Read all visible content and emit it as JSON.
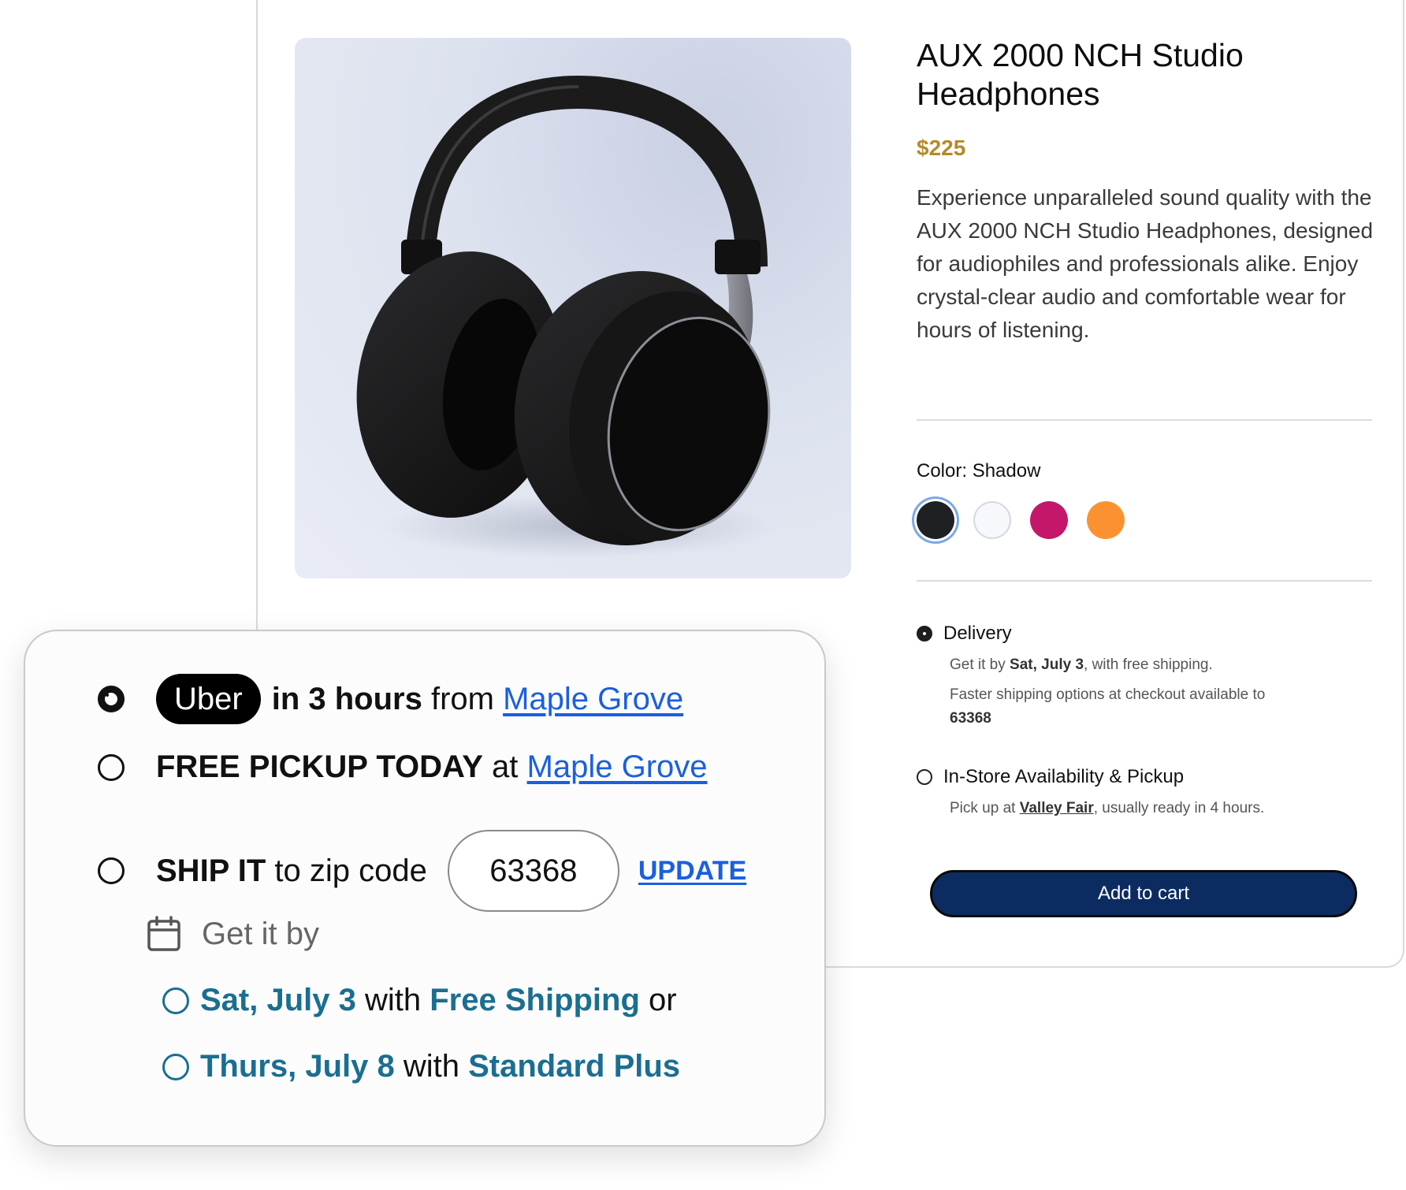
{
  "product": {
    "title": "AUX 2000 NCH Studio Headphones",
    "price": "$225",
    "description": "Experience unparalleled sound quality with the AUX 2000 NCH Studio Headphones, designed for audiophiles and professionals alike. Enjoy crystal-clear audio and comfortable wear for hours of listening.",
    "color_label": "Color: Shadow",
    "swatches": [
      {
        "name": "Shadow",
        "hex": "#1f2021",
        "selected": true
      },
      {
        "name": "White",
        "hex": "#f6f8fb",
        "selected": false
      },
      {
        "name": "Magenta",
        "hex": "#c4176b",
        "selected": false
      },
      {
        "name": "Orange",
        "hex": "#fb9231",
        "selected": false
      }
    ],
    "delivery": {
      "label": "Delivery",
      "line1_prefix": "Get it by ",
      "line1_date": "Sat, July 3",
      "line1_suffix": ", with free shipping.",
      "line2": "Faster shipping options at checkout available to",
      "zip": "63368"
    },
    "pickup": {
      "label": "In-Store Availability & Pickup",
      "prefix": "Pick up at ",
      "store": "Valley Fair",
      "suffix": ", usually ready in 4 hours."
    },
    "add_to_cart": "Add to cart"
  },
  "shipping": {
    "uber": {
      "brand": "Uber",
      "time": "in 3 hours",
      "from": " from ",
      "store": "Maple Grove"
    },
    "pickup": {
      "bold": "FREE PICKUP TODAY",
      "at": " at ",
      "store": "Maple Grove"
    },
    "ship": {
      "bold": "SHIP IT",
      "rest": " to zip code",
      "zip_value": "63368",
      "update": "UPDATE"
    },
    "get_it_by": "Get it by",
    "options": [
      {
        "date": "Sat, July 3",
        "with": " with ",
        "method": "Free Shipping",
        "tail": " or"
      },
      {
        "date": "Thurs, July 8",
        "with": " with ",
        "method": "Standard Plus",
        "tail": ""
      }
    ]
  },
  "colors": {
    "price": "#b48a2a",
    "link_blue": "#1a5fe0",
    "teal": "#1b6e91",
    "cart_button": "#0c2c61"
  }
}
